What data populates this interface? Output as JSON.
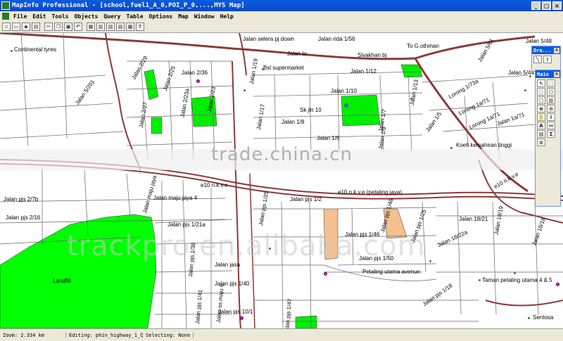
{
  "window": {
    "title": "MapInfo Professional - [school,fuel1_A_0,POI_P_0,...,MYS Map]"
  },
  "menu": [
    "File",
    "Edit",
    "Tools",
    "Objects",
    "Query",
    "Table",
    "Options",
    "Map",
    "Window",
    "Help"
  ],
  "toolbar_icons": [
    "new-icon",
    "open-icon",
    "save-icon",
    "print-icon",
    "cut-icon",
    "copy-icon",
    "paste-icon",
    "undo-icon",
    "layout-icon",
    "table-icon",
    "graph-icon",
    "map-icon",
    "browser-icon",
    "help-icon"
  ],
  "map": {
    "labels": [
      {
        "id": "continental",
        "text": "Continental tyres"
      },
      {
        "id": "jalan_selera",
        "text": "Jalan selera pj down"
      },
      {
        "id": "jalan_rida",
        "text": "Jalan rida 1/56"
      },
      {
        "id": "jalan_to",
        "text": "Jalan to"
      },
      {
        "id": "sivakhan",
        "text": "Sivakhan bj"
      },
      {
        "id": "togothman",
        "text": "To G.othman"
      },
      {
        "id": "jalan_548",
        "text": "Jalan 5/48"
      },
      {
        "id": "jalan_561",
        "text": "Jalan 5/61"
      },
      {
        "id": "jalan_5201",
        "text": "Jalan 5/201"
      },
      {
        "id": "jalan_229",
        "text": "Jalan 2/29"
      },
      {
        "id": "jalan_225",
        "text": "Jalan 2/25"
      },
      {
        "id": "jalan_236",
        "text": "Jalan 2/36"
      },
      {
        "id": "jalan_119",
        "text": "Jalan 1/19"
      },
      {
        "id": "bsl",
        "text": "Bsl supermarket"
      },
      {
        "id": "jalan_112",
        "text": "Jalan 1/12"
      },
      {
        "id": "jalan_544",
        "text": "Jalan 5/44"
      },
      {
        "id": "jalan_223a",
        "text": "Jalan 2/23a"
      },
      {
        "id": "jalan_223",
        "text": "Jalan 2/23"
      },
      {
        "id": "jalan_110",
        "text": "Jalan 1/10"
      },
      {
        "id": "jalan_113",
        "text": "Jalan 1/13"
      },
      {
        "id": "lorong_173a",
        "text": "Lorong 1/73a"
      },
      {
        "id": "jalan_227",
        "text": "Jalan 2/27"
      },
      {
        "id": "jalan_117",
        "text": "Jalan 1/17"
      },
      {
        "id": "skjln10",
        "text": "Sk jln 10"
      },
      {
        "id": "jalan_17",
        "text": "Jalan 1/7"
      },
      {
        "id": "jalan_15",
        "text": "Jalan 1/5"
      },
      {
        "id": "lorong_171",
        "text": "Lorong 1a/71"
      },
      {
        "id": "lorong_171b",
        "text": "Lorong 1a/71"
      },
      {
        "id": "jalan_18",
        "text": "Jalan 1/8"
      },
      {
        "id": "jalan_16",
        "text": "Jalan 1/6"
      },
      {
        "id": "jalan_19",
        "text": "Jalan 1/9"
      },
      {
        "id": "jalan_171",
        "text": "Jalan 1a/71"
      },
      {
        "id": "koeti",
        "text": "Koeti kemahiran tinggi"
      },
      {
        "id": "jalan_27b",
        "text": "Jalan pjs 2/7b"
      },
      {
        "id": "e10",
        "text": "e10 n.k.v.e"
      },
      {
        "id": "petaling_jaya",
        "text": "e10 n.k.v.e (petaling jaya)"
      },
      {
        "id": "e10_right",
        "text": "e10 n.k.v.e"
      },
      {
        "id": "jalan_maju_jaya",
        "text": "Jalan maju jaya"
      },
      {
        "id": "jalan_maju_jaya4",
        "text": "Jalan maju jaya 4"
      },
      {
        "id": "jalan_pjs12",
        "text": "Jalan pjs 1/2"
      },
      {
        "id": "jalan_pjs216",
        "text": "Jalan pjs 2/16"
      },
      {
        "id": "jalan_pjs121a",
        "text": "Jalan pjs 1/21a"
      },
      {
        "id": "jalan_pjs125",
        "text": "Jalan pjs 1/25"
      },
      {
        "id": "jalan_pjs146",
        "text": "Jalan pjs 1/46"
      },
      {
        "id": "jalan_pjs148",
        "text": "Jalan pjs 1/48"
      },
      {
        "id": "jalan_pjs1125",
        "text": "Jalan pjs 1/25"
      },
      {
        "id": "jalan_1821",
        "text": "Jalan 18/21"
      },
      {
        "id": "jalan_1819",
        "text": "Jalan 18/19"
      },
      {
        "id": "jalan_1822a",
        "text": "Jalan 18/22a"
      },
      {
        "id": "jalan_1818",
        "text": "Jalan 18/18"
      },
      {
        "id": "jalan_jasa",
        "text": "Jalan jasa"
      },
      {
        "id": "jalan_pjs150",
        "text": "Jalan pjs 1/50"
      },
      {
        "id": "petaling_utama",
        "text": "Petaling utama avenue"
      },
      {
        "id": "landfill",
        "text": "Landfill"
      },
      {
        "id": "jalan_pjs140",
        "text": "Jalan pjs 1/40"
      },
      {
        "id": "jalan_pjs1ver",
        "text": "Jalan pjs 1/38"
      },
      {
        "id": "jalan_pjs141",
        "text": "Jalan pjs 1/41"
      },
      {
        "id": "jalan_ss",
        "text": "Jalan ss.maju 6"
      },
      {
        "id": "jalan_pjs147",
        "text": "Jalan pjs 1/47"
      },
      {
        "id": "jalan_pjs118",
        "text": "Jalan pjs 1/18"
      },
      {
        "id": "taman",
        "text": "Taman petaling utama 4 & 5"
      },
      {
        "id": "jalan_pjs101",
        "text": "Jalan pjs 10/1"
      },
      {
        "id": "sentosa",
        "text": "Sentosa"
      }
    ]
  },
  "palettes": {
    "drawing": {
      "title": "Dra...",
      "tools": [
        "line-icon",
        "polyline-icon"
      ]
    },
    "main": {
      "title": "Main",
      "tools": [
        "select-icon",
        "marquee-icon",
        "radius-icon",
        "polygon-icon",
        "boundary-icon",
        "graph-select-icon",
        "zoom-in-icon",
        "zoom-out-icon",
        "hand-icon",
        "info-icon",
        "label-icon",
        "ruler-icon",
        "legend-icon",
        "stats-icon",
        "layer-icon"
      ]
    }
  },
  "watermarks": [
    "trade.china.cn",
    "trackpro.en.alibaba.com"
  ],
  "status": {
    "zoom": "Zoom: 2.334 km",
    "editing": "Editing: phin_highway_1_C",
    "selecting": "Selecting: None"
  }
}
